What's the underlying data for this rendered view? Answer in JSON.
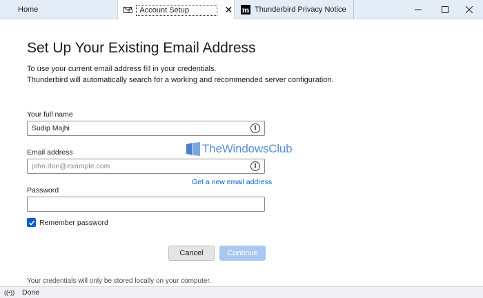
{
  "tabs": {
    "home": {
      "label": "Home"
    },
    "account_setup": {
      "label": "Account Setup",
      "close_label": "✕"
    },
    "privacy": {
      "label": "Thunderbird Privacy Notice"
    }
  },
  "window_controls": {
    "minimize": "—",
    "maximize": "☐",
    "close": "✕"
  },
  "page": {
    "title": "Set Up Your Existing Email Address",
    "intro_line1": "To use your current email address fill in your credentials.",
    "intro_line2": "Thunderbird will automatically search for a working and recommended server configuration."
  },
  "form": {
    "full_name": {
      "label": "Your full name",
      "value": "Sudip Majhi",
      "placeholder": ""
    },
    "email": {
      "label": "Email address",
      "value": "",
      "placeholder": "john.doe@example.com"
    },
    "new_email_link": "Get a new email address",
    "password": {
      "label": "Password",
      "value": ""
    },
    "remember_password": {
      "label": "Remember password",
      "checked": true
    }
  },
  "buttons": {
    "cancel": "Cancel",
    "continue": "Continue"
  },
  "footer_note": "Your credentials will only be stored locally on your computer.",
  "watermark": {
    "text": "TheWindowsClub"
  },
  "statusbar": {
    "text": "Done",
    "icon": "activity-icon"
  },
  "colors": {
    "accent": "#0061e0",
    "tab_bar": "#e3ecf7",
    "continue_disabled": "#a8c8ef"
  }
}
